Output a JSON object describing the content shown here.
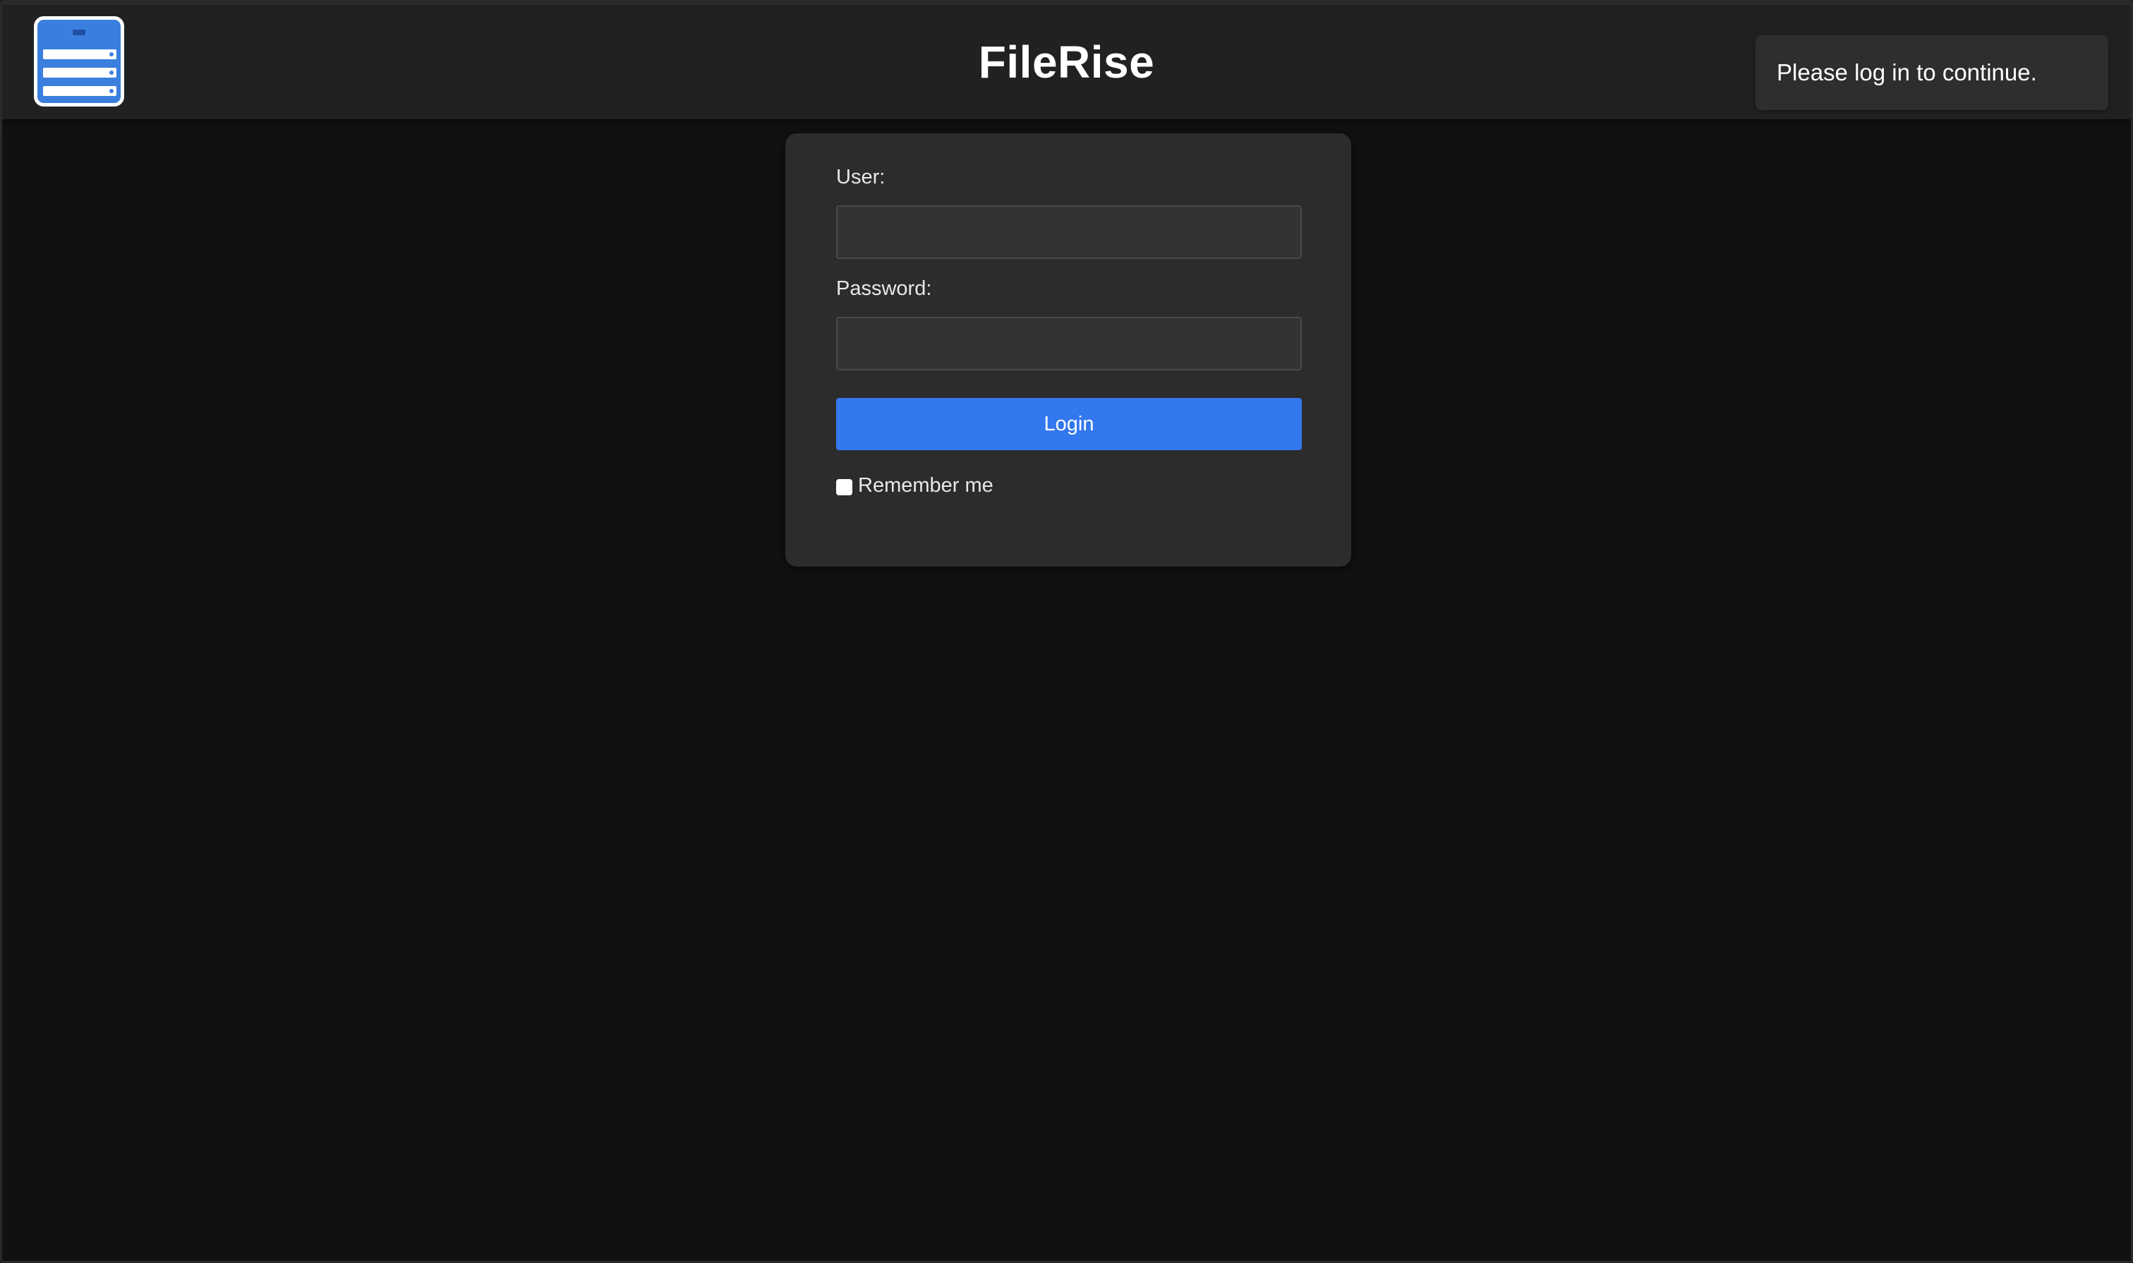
{
  "header": {
    "app_title": "FileRise",
    "logo_icon": "server-rack-icon"
  },
  "toast": {
    "message": "Please log in to continue."
  },
  "login_form": {
    "user_label": "User:",
    "user_value": "",
    "password_label": "Password:",
    "password_value": "",
    "login_button_label": "Login",
    "remember_label": "Remember me",
    "remember_checked": false
  },
  "colors": {
    "background": "#111111",
    "header": "#212121",
    "card": "#2c2c2c",
    "accent": "#3478f0",
    "logo": "#3a7fde"
  }
}
